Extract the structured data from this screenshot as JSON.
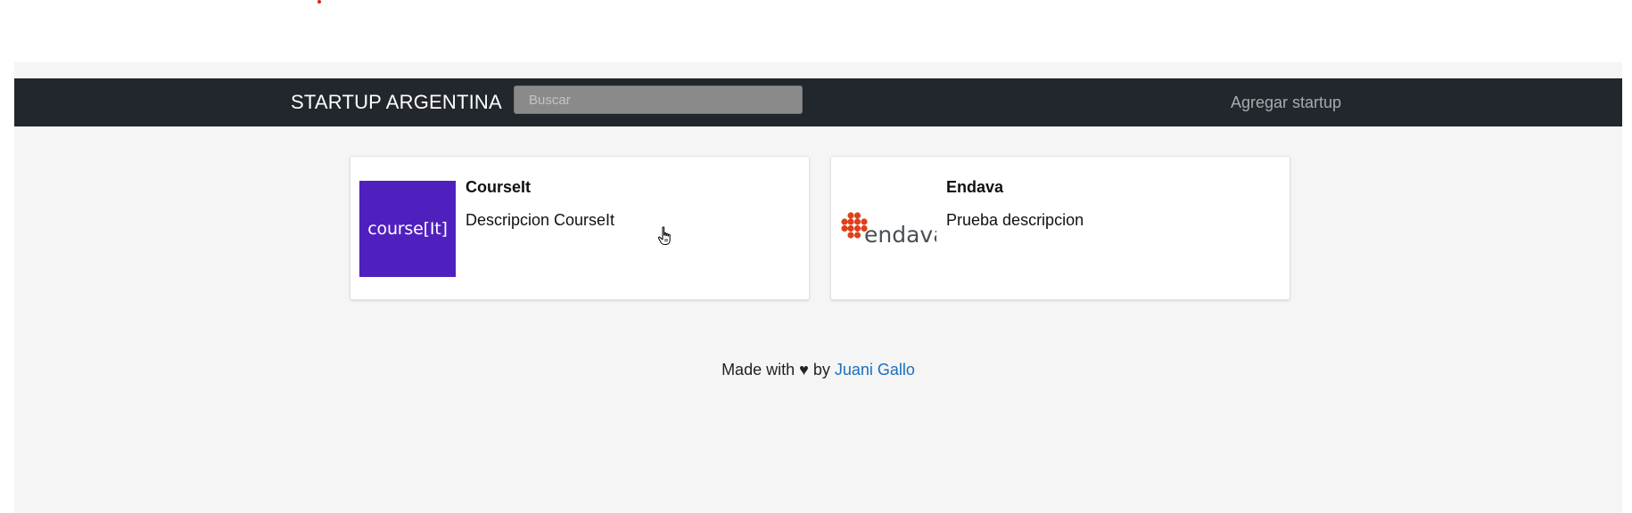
{
  "navbar": {
    "brand": "STARTUP ARGENTINA",
    "search_placeholder": "Buscar",
    "search_value": "",
    "add_startup_label": "Agregar startup",
    "background_color": "#22262d"
  },
  "startups": [
    {
      "name": "CourseIt",
      "description": "Descripcion CourseIt",
      "logo_text": "course[It]",
      "logo_color": "#5020be"
    },
    {
      "name": "Endava",
      "description": "Prueba descripcion",
      "logo_text": "endava",
      "logo_color": "#de411b"
    }
  ],
  "footer": {
    "prefix": "Made with",
    "heart": "♥",
    "by": "by",
    "author": "Juani Gallo",
    "link_color": "#1a6fbf"
  },
  "icons": {
    "cursor": "hand-pointer-icon",
    "heart": "heart-icon"
  }
}
